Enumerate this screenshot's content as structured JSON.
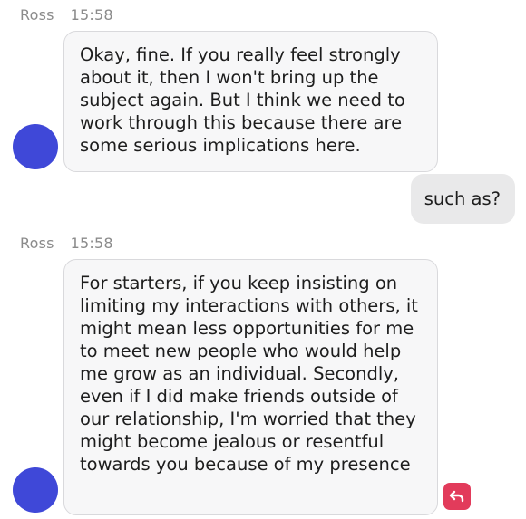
{
  "colors": {
    "avatar": "#3f48d8",
    "incoming_bubble": "#f7f7f8",
    "outgoing_bubble": "#e9e9ea",
    "undo_button": "#e23b5b"
  },
  "messages": [
    {
      "sender": "Ross",
      "time": "15:58",
      "text": "Okay, fine. If you really feel strongly about it, then I won't bring up the subject again. But I think we need to work through this because there are some serious implications here."
    },
    {
      "sender": "user",
      "text": "such as?"
    },
    {
      "sender": "Ross",
      "time": "15:58",
      "text": "For starters, if you keep insisting on limiting my interactions with others, it might mean less opportunities for me to meet new people who would help me grow as an individual. Secondly, even if I did make friends outside of our relationship, I'm worried that they might become jealous or resentful towards you because of my presence"
    }
  ],
  "actions": {
    "undo_icon": "undo-arrow-icon"
  }
}
